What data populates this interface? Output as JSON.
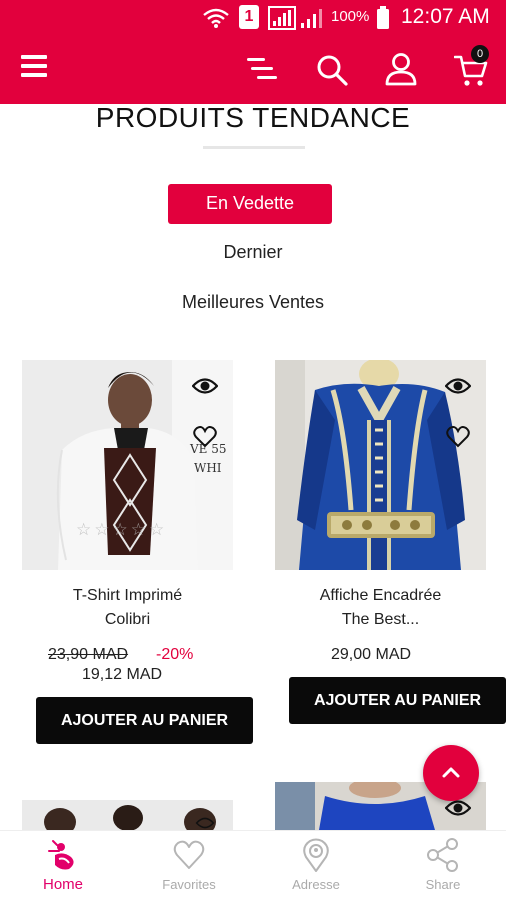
{
  "status_bar": {
    "battery": "100%",
    "time": "12:07 AM",
    "sim": "1",
    "icons": [
      "wifi-icon",
      "sim-icon",
      "signal-icon",
      "battery-icon"
    ]
  },
  "app_bar": {
    "icons": [
      "menu-icon",
      "filter-icon",
      "search-icon",
      "user-icon",
      "cart-icon"
    ],
    "cart_count": "0"
  },
  "section": {
    "title": "PRODUITS TENDANCE",
    "tabs": [
      {
        "label": "En Vedette",
        "active": true
      },
      {
        "label": "Dernier",
        "active": false
      },
      {
        "label": "Meilleures Ventes",
        "active": false
      }
    ]
  },
  "products": [
    {
      "name_line1": "T-Shirt Imprimé",
      "name_line2": "Colibri",
      "old_price": "23,90 MAD",
      "discount": "-20%",
      "price": "19,12 MAD",
      "button": "AJOUTER AU PANIER",
      "image_text": [
        "VE 55",
        "WHI"
      ],
      "rating": 0
    },
    {
      "name_line1": "Affiche Encadrée",
      "name_line2": "The Best...",
      "price": "29,00 MAD",
      "button": "AJOUTER AU PANIER"
    }
  ],
  "bottom_nav": [
    {
      "label": "Home",
      "icon": "home-icon",
      "active": true
    },
    {
      "label": "Favorites",
      "icon": "heart-icon",
      "active": false
    },
    {
      "label": "Adresse",
      "icon": "location-icon",
      "active": false
    },
    {
      "label": "Share",
      "icon": "share-icon",
      "active": false
    }
  ],
  "colors": {
    "primary": "#e2003d",
    "button": "#0a0a0a",
    "discount": "#e2003d",
    "nav_active": "#e2006a"
  }
}
